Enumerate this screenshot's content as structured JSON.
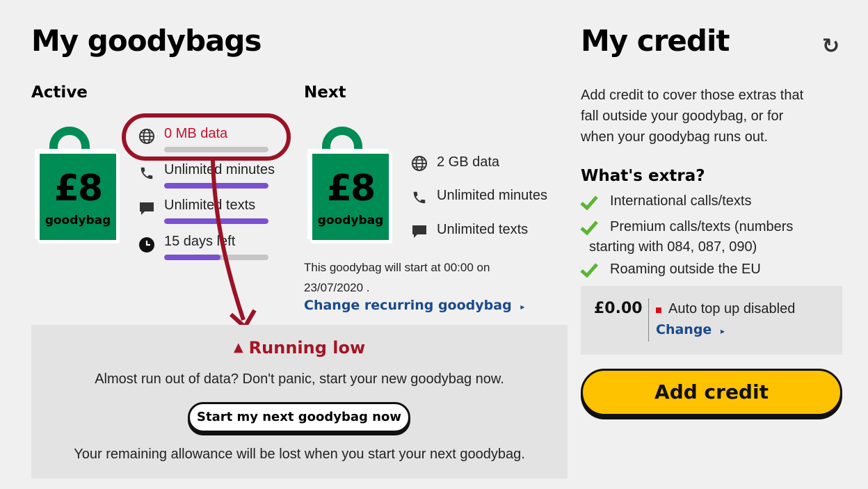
{
  "goodybags": {
    "title": "My goodybags",
    "active": {
      "heading": "Active",
      "bag_price": "£8",
      "bag_label": "goodybag",
      "allowances": [
        {
          "icon": "globe-icon",
          "label": "0 MB data",
          "progress": 0,
          "color": "#c8102e"
        },
        {
          "icon": "phone-icon",
          "label": "Unlimited minutes",
          "progress": 1
        },
        {
          "icon": "speech-bubble-icon",
          "label": "Unlimited texts",
          "progress": 1
        },
        {
          "icon": "clock-icon",
          "label": "15 days left",
          "progress": 0.54
        }
      ]
    },
    "next": {
      "heading": "Next",
      "bag_price": "£8",
      "bag_label": "goodybag",
      "allowances": [
        {
          "icon": "globe-icon",
          "label": "2 GB data"
        },
        {
          "icon": "phone-icon",
          "label": "Unlimited minutes"
        },
        {
          "icon": "speech-bubble-icon",
          "label": "Unlimited texts"
        }
      ],
      "start_note_line1": "This goodybag will start at 00:00 on",
      "start_note_line2": "23/07/2020 .",
      "change_link": "Change recurring goodybag",
      "link_arrow": "▸"
    },
    "running_low": {
      "title": "Running low",
      "message": "Almost run out of data? Don't panic, start your new goodybag now.",
      "button": "Start my next goodybag now",
      "warning": "Your remaining allowance will be lost when you start your next goodybag.",
      "warning_icon": "▲"
    }
  },
  "credit": {
    "title": "My credit",
    "refresh_icon": "↻",
    "description_lines": [
      "Add credit to cover those extras that",
      "fall outside your goodybag, or for",
      "when your goodybag runs out."
    ],
    "extras_heading": "What's extra?",
    "extras": [
      {
        "line1": "International calls/texts"
      },
      {
        "line1": "Premium calls/texts (numbers",
        "line2": "starting with 084, 087, 090)"
      },
      {
        "line1": "Roaming outside the EU"
      }
    ],
    "balance": "£0.00",
    "auto_top_up": "Auto top up disabled",
    "change_link": "Change",
    "link_arrow": "▸",
    "add_button": "Add credit"
  },
  "colors": {
    "bag_green": "#008c55",
    "alert_red": "#a31524",
    "link_blue": "#1a4a8a",
    "bar_purple": "#7b4fd1",
    "button_yellow": "#ffc200",
    "check_green": "#5cb531"
  }
}
